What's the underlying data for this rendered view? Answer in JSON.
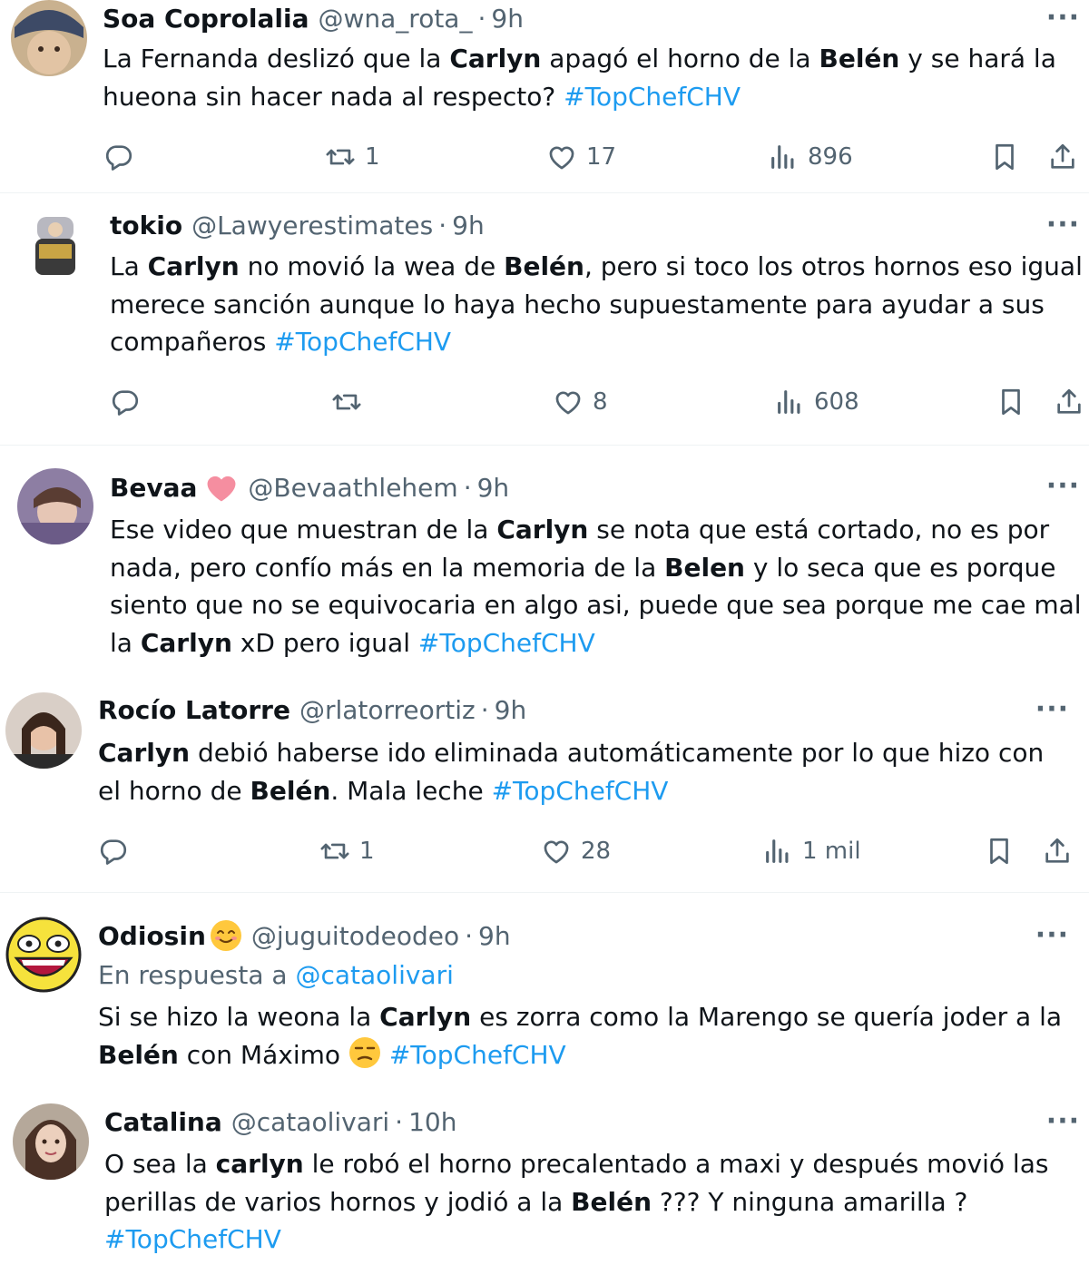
{
  "tweets": [
    {
      "name": "Soa Coprolalia",
      "handle": "@wna_rota_",
      "time": "9h",
      "more": "···",
      "lines": [
        [
          "La Fernanda deslizó que la ",
          "Carlyn",
          " apagó el horno de la ",
          "Belén",
          " y se hará la"
        ],
        [
          "hueona sin hacer nada al respecto? "
        ],
        [
          "#TopChefCHV"
        ]
      ],
      "replies": "",
      "retweets": "1",
      "likes": "17",
      "views": "896"
    },
    {
      "name": "tokio",
      "handle": "@Lawyerestimates",
      "time": "9h",
      "more": "···",
      "l1a": "La ",
      "l1b": "Carlyn",
      "l1c": " no movió la wea de ",
      "l1d": "Belén",
      "l1e": ", pero si toco los otros hornos eso igual",
      "l2": "merece sanción aunque lo haya hecho supuestamente para ayudar a sus",
      "l3": "compañeros ",
      "tag": "#TopChefCHV",
      "retweets": "",
      "likes": "8",
      "views": "608"
    },
    {
      "name": "Bevaa",
      "handle": "@Bevaathlehem",
      "time": "9h",
      "more": "···",
      "l1a": "Ese video que muestran de la ",
      "l1b": "Carlyn",
      "l1c": " se nota que está cortado, no es por",
      "l2a": "nada, pero confío más en la memoria de la ",
      "l2b": "Belen",
      "l2c": " y lo seca que es porque",
      "l3": "siento que no se equivocaria en algo asi, puede que sea porque me cae mal",
      "l4a": "la ",
      "l4b": "Carlyn",
      "l4c": " xD pero igual ",
      "tag": "#TopChefCHV"
    },
    {
      "name": "Rocío Latorre",
      "handle": "@rlatorreortiz",
      "time": "9h",
      "more": "···",
      "l1a": "Carlyn",
      "l1b": " debió haberse ido eliminada automáticamente por lo que hizo con",
      "l2a": "el horno de ",
      "l2b": "Belén",
      "l2c": ". Mala leche ",
      "tag": "#TopChefCHV",
      "retweets": "1",
      "likes": "28",
      "views": "1 mil"
    },
    {
      "name": "Odiosin",
      "handle": "@juguitodeodeo",
      "time": "9h",
      "more": "···",
      "reply_prefix": "En respuesta a ",
      "reply_mention": "@cataolivari",
      "l1a": "Si se hizo la weona la ",
      "l1b": "Carlyn",
      "l1c": " es zorra como la Marengo se quería joder a la",
      "l2a": "Belén",
      "l2b": " con Máximo ",
      "tag": "#TopChefCHV"
    },
    {
      "name": "Catalina",
      "handle": "@cataolivari",
      "time": "10h",
      "more": "···",
      "l1a": "O sea la ",
      "l1b": "carlyn",
      "l1c": " le robó el horno precalentado a maxi y después movió las",
      "l2a": "perillas de varios hornos y jodió a la ",
      "l2b": "Belén",
      "l2c": " ??? Y ninguna amarilla ?",
      "tag": "#TopChefCHV"
    }
  ],
  "icons": {
    "reply": "reply-icon",
    "retweet": "retweet-icon",
    "like": "heart-icon",
    "views": "views-icon",
    "bookmark": "bookmark-icon",
    "share": "share-icon"
  },
  "colors": {
    "link": "#1d9bf0",
    "muted": "#536471",
    "text": "#0f1419",
    "heart_emoji": "#f58ea0"
  }
}
